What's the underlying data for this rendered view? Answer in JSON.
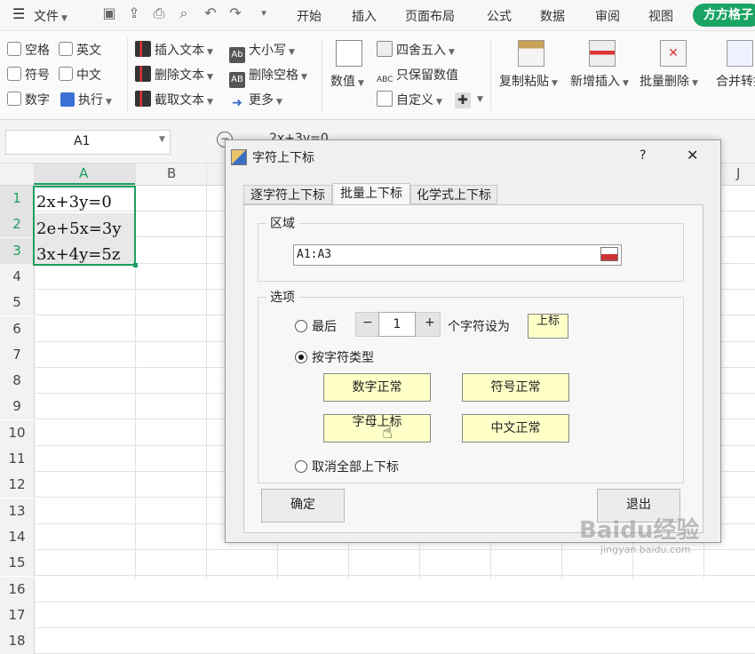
{
  "menubar": {
    "file_label": "文件",
    "tabs": [
      "开始",
      "插入",
      "页面布局",
      "公式",
      "数据",
      "审阅",
      "视图"
    ],
    "brand": "方方格子"
  },
  "ribbon": {
    "checks": {
      "space": "空格",
      "english": "英文",
      "symbol": "符号",
      "chinese": "中文",
      "digit": "数字"
    },
    "execute": "执行",
    "insert_text": "插入文本",
    "delete_text": "删除文本",
    "extract_text": "截取文本",
    "case": "大小写",
    "delete_space": "删除空格",
    "more": "更多",
    "value": "数值",
    "round": "四舍五入",
    "keep_value": "只保留数值",
    "custom": "自定义",
    "copy_paste": "复制粘贴",
    "new_insert": "新增插入",
    "batch_delete": "批量删除",
    "merge_convert": "合并转换"
  },
  "formula_bar": {
    "cell_ref": "A1",
    "formula": "2x+3y=0"
  },
  "grid": {
    "columns": [
      "A",
      "B",
      "J"
    ],
    "rows": [
      "1",
      "2",
      "3",
      "4",
      "5",
      "6",
      "7",
      "8",
      "9",
      "10",
      "11",
      "12",
      "13",
      "14",
      "15",
      "16",
      "17",
      "18"
    ],
    "cells": [
      "2x+3y=0",
      "2e+5x=3y",
      "3x+4y=5z"
    ]
  },
  "dialog": {
    "title": "字符上下标",
    "help": "?",
    "close": "✕",
    "tabs": [
      "逐字符上下标",
      "批量上下标",
      "化学式上下标"
    ],
    "area_label": "区域",
    "range_value": "A1:A3",
    "options_label": "选项",
    "last_label": "最后",
    "minus": "−",
    "count": "1",
    "plus": "+",
    "chars_set_as": "个字符设为",
    "superscript": "上标",
    "by_char_type": "按字符类型",
    "digit_normal": "数字正常",
    "symbol_normal": "符号正常",
    "letter_superscript": "字母上标",
    "chinese_normal": "中文正常",
    "cancel_all": "取消全部上下标",
    "ok": "确定",
    "exit": "退出"
  },
  "watermark": {
    "text": "Baidu经验",
    "url": "jingyan.baidu.com"
  }
}
